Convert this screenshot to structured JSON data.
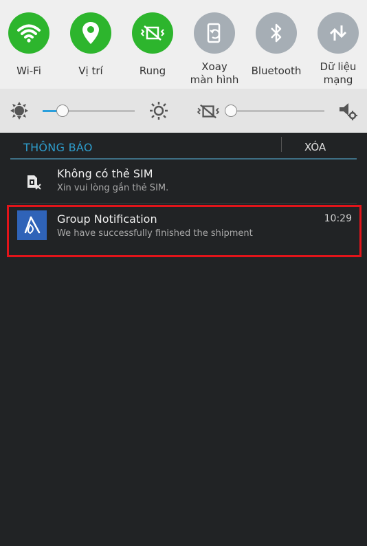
{
  "quick_settings": {
    "tiles": [
      {
        "label": "Wi-Fi",
        "icon": "wifi-icon",
        "state": "on"
      },
      {
        "label": "Vị trí",
        "icon": "location-icon",
        "state": "on"
      },
      {
        "label": "Rung",
        "icon": "vibrate-icon",
        "state": "on"
      },
      {
        "label": "Xoay\nmàn hình",
        "icon": "rotate-icon",
        "state": "off"
      },
      {
        "label": "Bluetooth",
        "icon": "bluetooth-icon",
        "state": "off"
      },
      {
        "label": "Dữ liệu\nmạng",
        "icon": "mobile-data-icon",
        "state": "off"
      }
    ],
    "brightness_level": 0.22,
    "volume_level": 0.0
  },
  "notifications_panel": {
    "title": "THÔNG BÁO",
    "clear_label": "XÓA",
    "items": [
      {
        "title": "Không có thẻ SIM",
        "subtitle": "Xin vui lòng gắn thẻ SIM.",
        "time": "",
        "icon": "no-sim-icon"
      },
      {
        "title": "Group Notification",
        "subtitle": "We have successfully finished the shipment",
        "time": "10:29",
        "icon": "app-icon"
      }
    ]
  },
  "colors": {
    "tile_on": "#2db52d",
    "tile_off": "#a6aeb5",
    "accent": "#2e9dcc",
    "highlight": "#e2141a"
  }
}
